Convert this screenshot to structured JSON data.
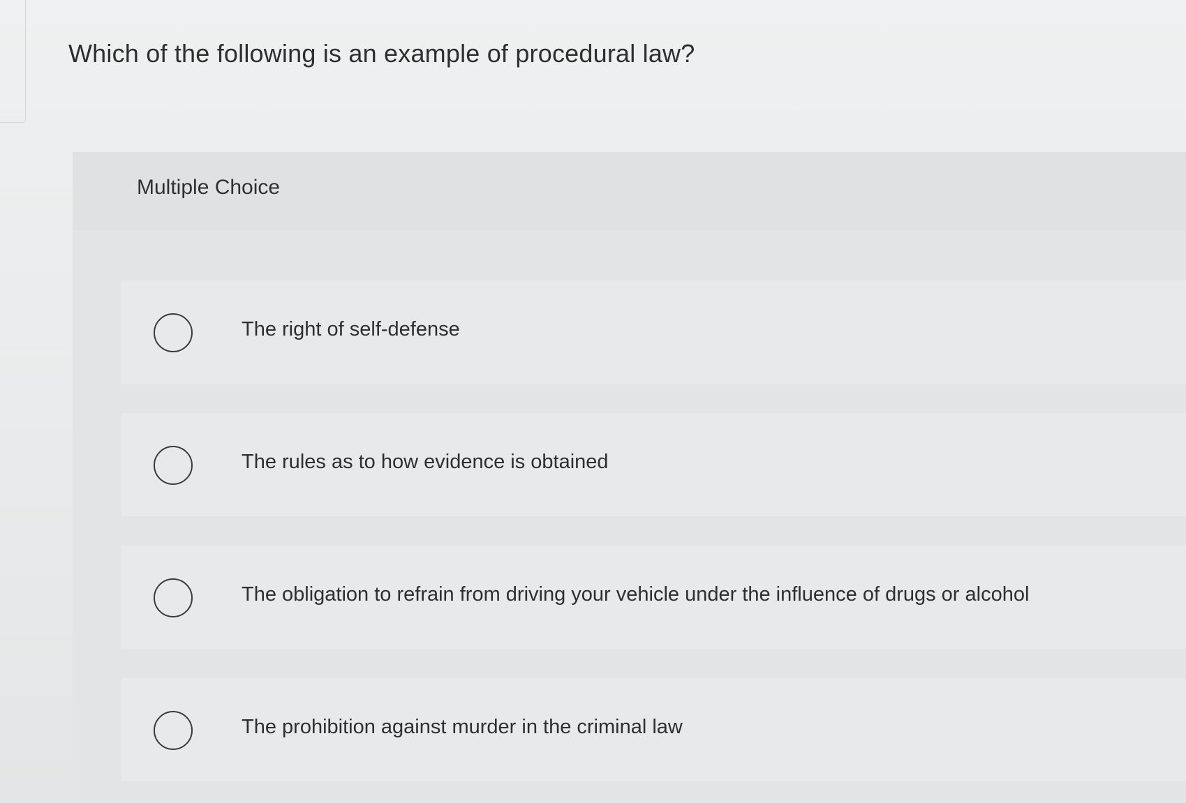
{
  "question": {
    "text": "Which of the following is an example of procedural law?"
  },
  "multiple_choice": {
    "label": "Multiple Choice",
    "options": [
      {
        "text": "The right of self-defense",
        "selected": false
      },
      {
        "text": "The rules as to how evidence is obtained",
        "selected": false
      },
      {
        "text": "The obligation to refrain from driving your vehicle under the influence of drugs or alcohol",
        "selected": false
      },
      {
        "text": "The prohibition against murder in the criminal law",
        "selected": false
      }
    ]
  }
}
